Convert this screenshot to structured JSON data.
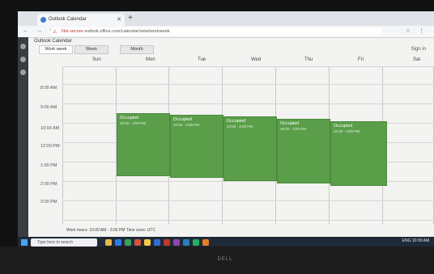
{
  "browser": {
    "tab_title": "Outlook Calendar",
    "url_prefix": "Not secure",
    "url_text": "outlook.office.com/calendar/view/workweek"
  },
  "page": {
    "title": "Outlook Calendar",
    "view_tabs": [
      "Work week",
      "Week",
      "Month"
    ],
    "user": "Sign in"
  },
  "calendar": {
    "days": [
      "Sun",
      "Mon",
      "Tue",
      "Wed",
      "Thu",
      "Fri",
      "Sat"
    ],
    "times": [
      "8:00 AM",
      "9:00 AM",
      "10:00 AM",
      "12:00 PM",
      "1:00 PM",
      "2:00 PM",
      "3:00 PM"
    ],
    "events": [
      {
        "day": "Mon",
        "title": "Occupied",
        "sub": "10:00 - 3:00 PM"
      },
      {
        "day": "Tue",
        "title": "Occupied",
        "sub": "10:00 - 3:00 PM"
      },
      {
        "day": "Wed",
        "title": "Occupied",
        "sub": "10:00 - 3:00 PM"
      },
      {
        "day": "Thu",
        "title": "Occupied",
        "sub": "10:00 - 3:00 PM"
      },
      {
        "day": "Fri",
        "title": "Occupied",
        "sub": "10:00 - 3:00 PM"
      }
    ]
  },
  "status_bar": {
    "text": "Work hours: 10:00 AM - 3:00 PM    Time zone: UTC"
  },
  "taskbar": {
    "search_placeholder": "Type here to search",
    "tray_text": "ENG  10:00 AM"
  },
  "monitor": {
    "brand": "DELL"
  }
}
